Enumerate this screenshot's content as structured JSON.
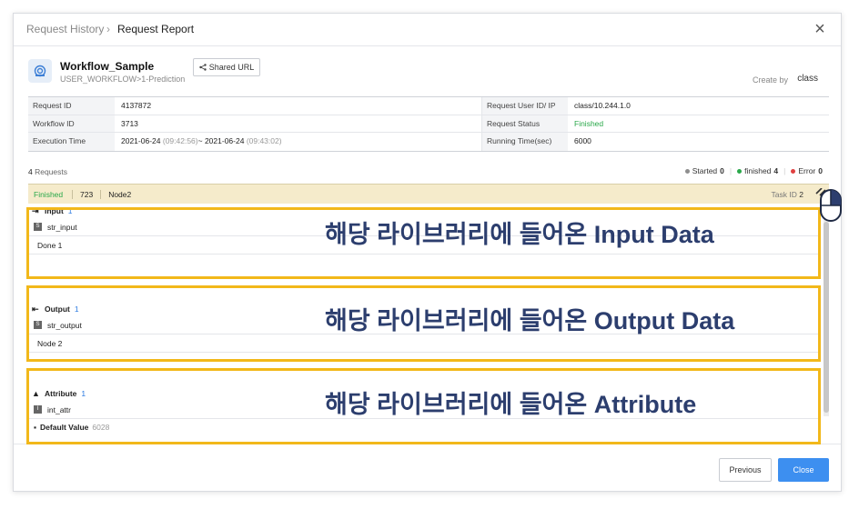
{
  "header": {
    "breadcrumb_parent": "Request History",
    "breadcrumb_sep": "›",
    "breadcrumb_current": "Request Report",
    "close_icon": "×"
  },
  "workflow": {
    "name": "Workflow_Sample",
    "path": "USER_WORKFLOW>1-Prediction",
    "shared_url_label": "Shared URL",
    "create_by_label": "Create by",
    "create_by_value": "class"
  },
  "info": {
    "request_id_label": "Request ID",
    "request_id": "4137872",
    "user_label": "Request User ID/ IP",
    "user_value": "class/10.244.1.0",
    "workflow_id_label": "Workflow ID",
    "workflow_id": "3713",
    "status_label": "Request Status",
    "status_value": "Finished",
    "exec_label": "Execution Time",
    "exec_start_date": "2021-06-24",
    "exec_start_time": "(09:42:56)",
    "exec_tilde": "~",
    "exec_end_date": "2021-06-24",
    "exec_end_time": "(09:43:02)",
    "running_label": "Running Time(sec)",
    "running_value": "6000"
  },
  "requests": {
    "count": "4",
    "label": "Requests",
    "legend": [
      {
        "label": "Started",
        "count": "0",
        "color": "#8e8e8e"
      },
      {
        "label": "finished",
        "count": "4",
        "color": "#2aa84a"
      },
      {
        "label": "Error",
        "count": "0",
        "color": "#e04040"
      }
    ]
  },
  "status_bar": {
    "status": "Finished",
    "number": "723",
    "node": "Node2",
    "task_label": "Task ID",
    "task_id": "2"
  },
  "sections": {
    "input": {
      "title": "Input",
      "count": "1",
      "param_tag": "S",
      "param": "str_input",
      "value": "Done 1"
    },
    "output": {
      "title": "Output",
      "count": "1",
      "param_tag": "S",
      "param": "str_output",
      "value": "Node 2"
    },
    "attribute": {
      "title": "Attribute",
      "count": "1",
      "param_tag": "I",
      "param": "int_attr",
      "default_label": "Default Value",
      "default_value": "6028"
    }
  },
  "overlays": {
    "input": "해당 라이브러리에 들어온 Input Data",
    "output": "해당 라이브러리에 들어온 Output Data",
    "attribute": "해당 라이브러리에 들어온 Attribute"
  },
  "footer": {
    "previous": "Previous",
    "close": "Close"
  },
  "colors": {
    "accent": "#3d8ff0",
    "finished": "#2aa84a",
    "highlight_border": "#f2b81a",
    "status_bar_bg": "#f5ebcb"
  }
}
